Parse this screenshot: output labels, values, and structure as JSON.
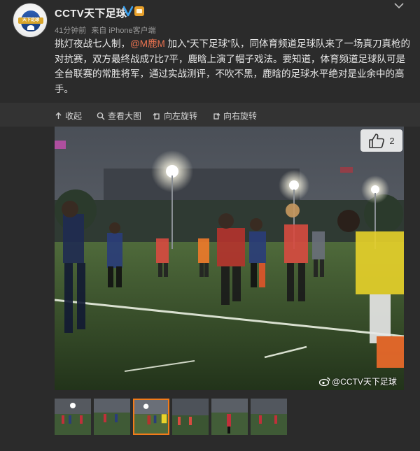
{
  "account": {
    "name": "CCTV天下足球",
    "avatar_text": "天下足球",
    "verified_icon": "verified-v-icon",
    "member_icon": "member-crown-icon"
  },
  "meta": {
    "time": "41分钟前",
    "source": "来自 iPhone客户端"
  },
  "post": {
    "text_before": "挑灯夜战七人制，",
    "mention": "@M鹿M",
    "text_after": " 加入“天下足球”队，同体育频道足球队来了一场真刀真枪的对抗赛，双方最终战成7比7平，鹿晗上演了帽子戏法。要知道，体育频道足球队可是全台联赛的常胜将军，通过实战测评，不吹不黑，鹿晗的足球水平绝对是业余中的高手。"
  },
  "toolbar": {
    "collapse": "收起",
    "view_large": "查看大图",
    "rotate_left": "向左旋转",
    "rotate_right": "向右旋转"
  },
  "photo": {
    "like_count": "2",
    "watermark": "@CCTV天下足球"
  },
  "thumbnails": {
    "count": 6,
    "active_index": 2
  },
  "colors": {
    "background": "#2b2b2b",
    "toolbar": "#333333",
    "mention": "#eb7350",
    "active_thumb_border": "#f27b1a"
  }
}
